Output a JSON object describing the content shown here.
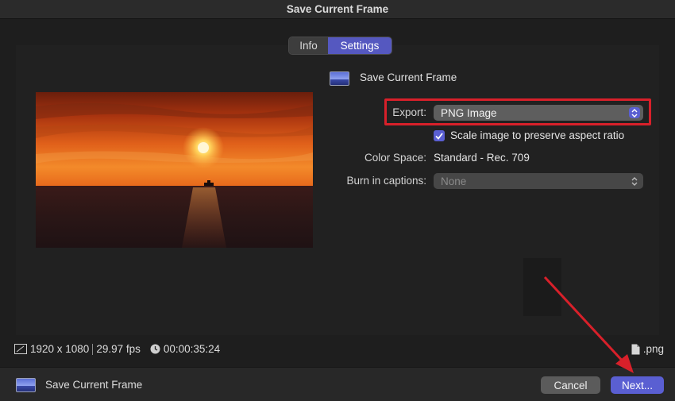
{
  "window": {
    "title": "Save Current Frame"
  },
  "tabs": [
    {
      "label": "Info",
      "selected": false
    },
    {
      "label": "Settings",
      "selected": true
    }
  ],
  "preset": {
    "title": "Save Current Frame",
    "icon": "frame-preset-icon"
  },
  "settings": {
    "export_label": "Export:",
    "export_value": "PNG Image",
    "scale_checkbox_label": "Scale image to preserve aspect ratio",
    "scale_checked": true,
    "color_space_label": "Color Space:",
    "color_space_value": "Standard - Rec. 709",
    "burn_label": "Burn in captions:",
    "burn_value": "None"
  },
  "info": {
    "resolution": "1920 x 1080",
    "frame_rate": "29.97 fps",
    "duration": "00:00:35:24",
    "extension": ".png"
  },
  "footer": {
    "title": "Save Current Frame",
    "cancel_label": "Cancel",
    "next_label": "Next..."
  },
  "colors": {
    "accent": "#5a5fd2",
    "annotation": "#d8202a"
  }
}
